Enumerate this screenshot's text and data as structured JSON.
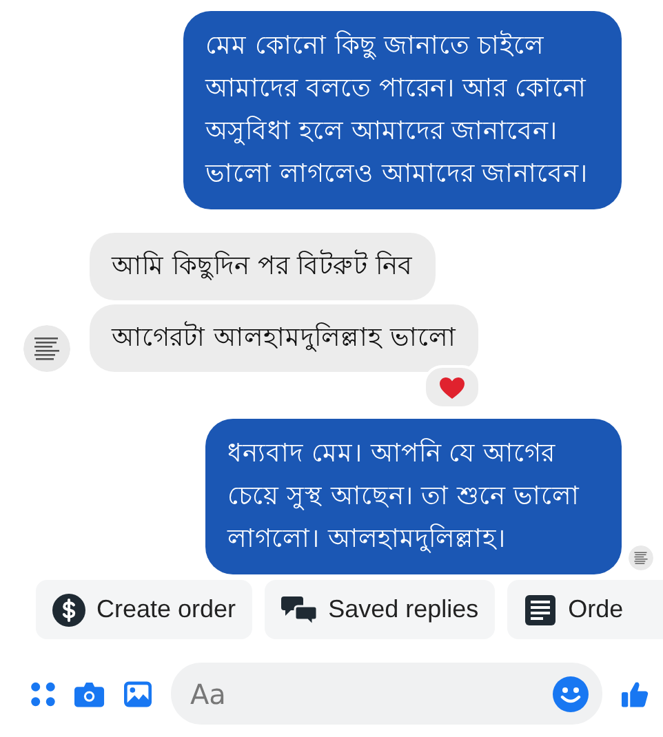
{
  "messages": [
    {
      "kind": "outgoing",
      "text": "মেম কোনো কিছু জানাতে চাইলে আমাদের বলতে পারেন। আর কোনো অসুবিধা হলে আমাদের জানাবেন। ভালো লাগলেও আমাদের জানাবেন।",
      "avatar": false
    },
    {
      "kind": "incoming",
      "text": "আমি কিছুদিন পর বিটরুট নিব",
      "avatar": false
    },
    {
      "kind": "incoming",
      "text": "আগেরটা আলহামদুলিল্লাহ ভালো",
      "avatar": true,
      "reaction": {
        "kind": "heart"
      }
    },
    {
      "kind": "outgoing",
      "text": "ধন্যবাদ মেম। আপনি যে আগের চেয়ে সুস্থ আছেন। তা শুনে ভালো লাগলো। আলহামদুলিল্লাহ।",
      "avatar": false,
      "seen": true
    }
  ],
  "quick_replies": [
    {
      "kind": "dollar",
      "label": "Create order"
    },
    {
      "kind": "chat",
      "label": "Saved replies"
    },
    {
      "kind": "list",
      "label": "Orde"
    }
  ],
  "composer": {
    "placeholder": "Aa"
  }
}
